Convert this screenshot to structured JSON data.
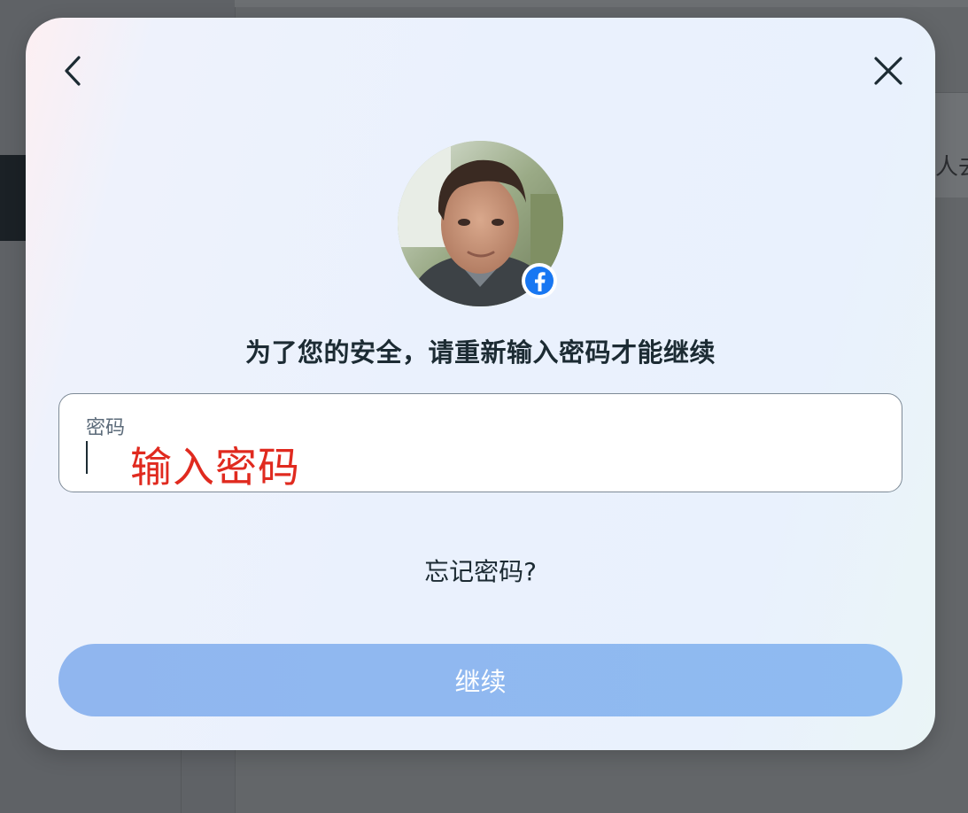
{
  "background": {
    "partial_text": "人去"
  },
  "modal": {
    "title": "为了您的安全，请重新输入密码才能继续",
    "password_field": {
      "label": "密码",
      "value": "",
      "overlay_hint": "输入密码"
    },
    "forgot_link": "忘记密码?",
    "continue_label": "继续",
    "avatar_badge": "facebook-icon"
  },
  "colors": {
    "accent": "#0866ff",
    "button_disabled": "#8fb8f0",
    "hint_red": "#e02a1f",
    "text": "#1c2b33"
  }
}
